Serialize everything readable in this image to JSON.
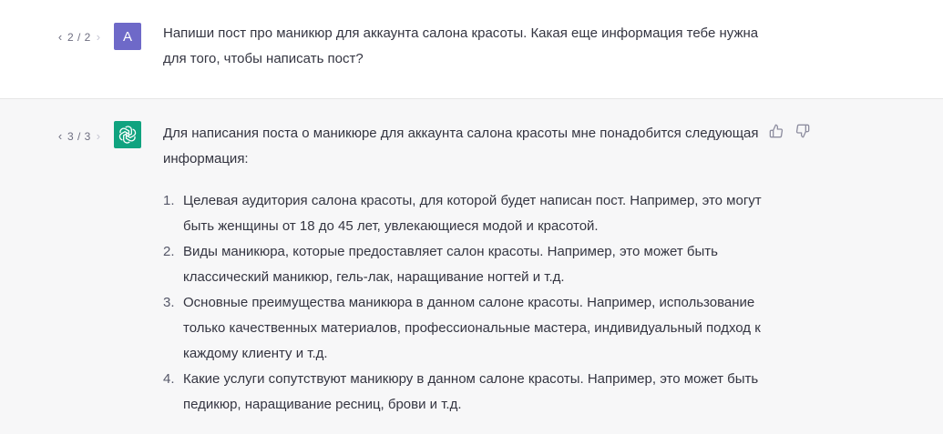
{
  "user_message": {
    "pager": {
      "prev": "‹",
      "count": "2 / 2",
      "next": "›"
    },
    "avatar_letter": "A",
    "text": "Напиши пост про маникюр для аккаунта салона красоты. Какая еще информация тебе нужна для того, чтобы написать пост?"
  },
  "assistant_message": {
    "pager": {
      "prev": "‹",
      "count": "3 / 3",
      "next": "›"
    },
    "avatar_icon": "openai-logo-icon",
    "intro": "Для написания поста о маникюре для аккаунта салона красоты мне понадобится следующая информация:",
    "items": [
      {
        "num": "1.",
        "text": "Целевая аудитория салона красоты, для которой будет написан пост. Например, это могут быть женщины от 18 до 45 лет, увлекающиеся модой и красотой."
      },
      {
        "num": "2.",
        "text": "Виды маникюра, которые предоставляет салон красоты. Например, это может быть классический маникюр, гель-лак, наращивание ногтей и т.д."
      },
      {
        "num": "3.",
        "text": "Основные преимущества маникюра в данном салоне красоты. Например, использование только качественных материалов, профессиональные мастера, индивидуальный подход к каждому клиенту и т.д."
      },
      {
        "num": "4.",
        "text": "Какие услуги сопутствуют маникюру в данном салоне красоты. Например, это может быть педикюр, наращивание ресниц, брови и т.д."
      }
    ],
    "feedback_icons": [
      "thumbs-up-icon",
      "thumbs-down-icon"
    ]
  },
  "colors": {
    "user_avatar": "#6e69c8",
    "assistant_avatar": "#10a37f",
    "assistant_bg": "#f7f7f8",
    "text": "#343541"
  }
}
